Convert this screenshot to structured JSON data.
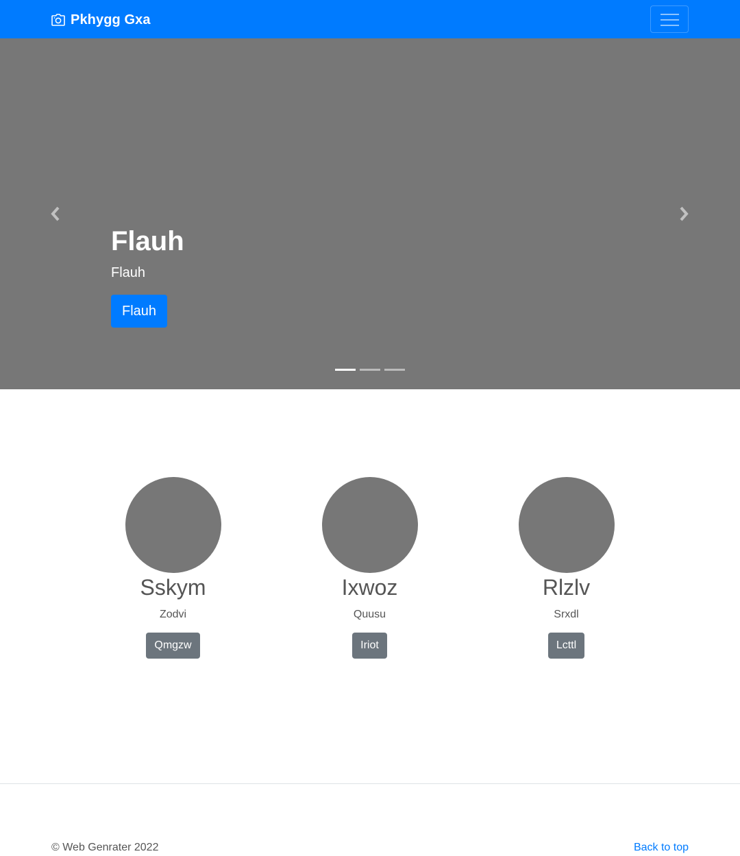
{
  "navbar": {
    "brand_icon": "camera-icon",
    "brand_text": "Pkhygg Gxa",
    "toggler_icon": "hamburger-menu-icon",
    "background": "#007bff"
  },
  "carousel": {
    "background": "#777777",
    "prev_icon": "chevron-left-icon",
    "next_icon": "chevron-right-icon",
    "slide": {
      "heading": "Flauh",
      "text": "Flauh",
      "button_label": "Flauh"
    },
    "indicators": {
      "count": 3,
      "active": 1
    }
  },
  "features": [
    {
      "title": "Sskym",
      "text": "Zodvi",
      "button_label": "Qmgzw"
    },
    {
      "title": "Ixwoz",
      "text": "Quusu",
      "button_label": "Iriot"
    },
    {
      "title": "Rlzlv",
      "text": "Srxdl",
      "button_label": "Lcttl"
    }
  ],
  "footer": {
    "copyright": "© Web Genrater 2022",
    "back_to_top": "Back to top"
  }
}
